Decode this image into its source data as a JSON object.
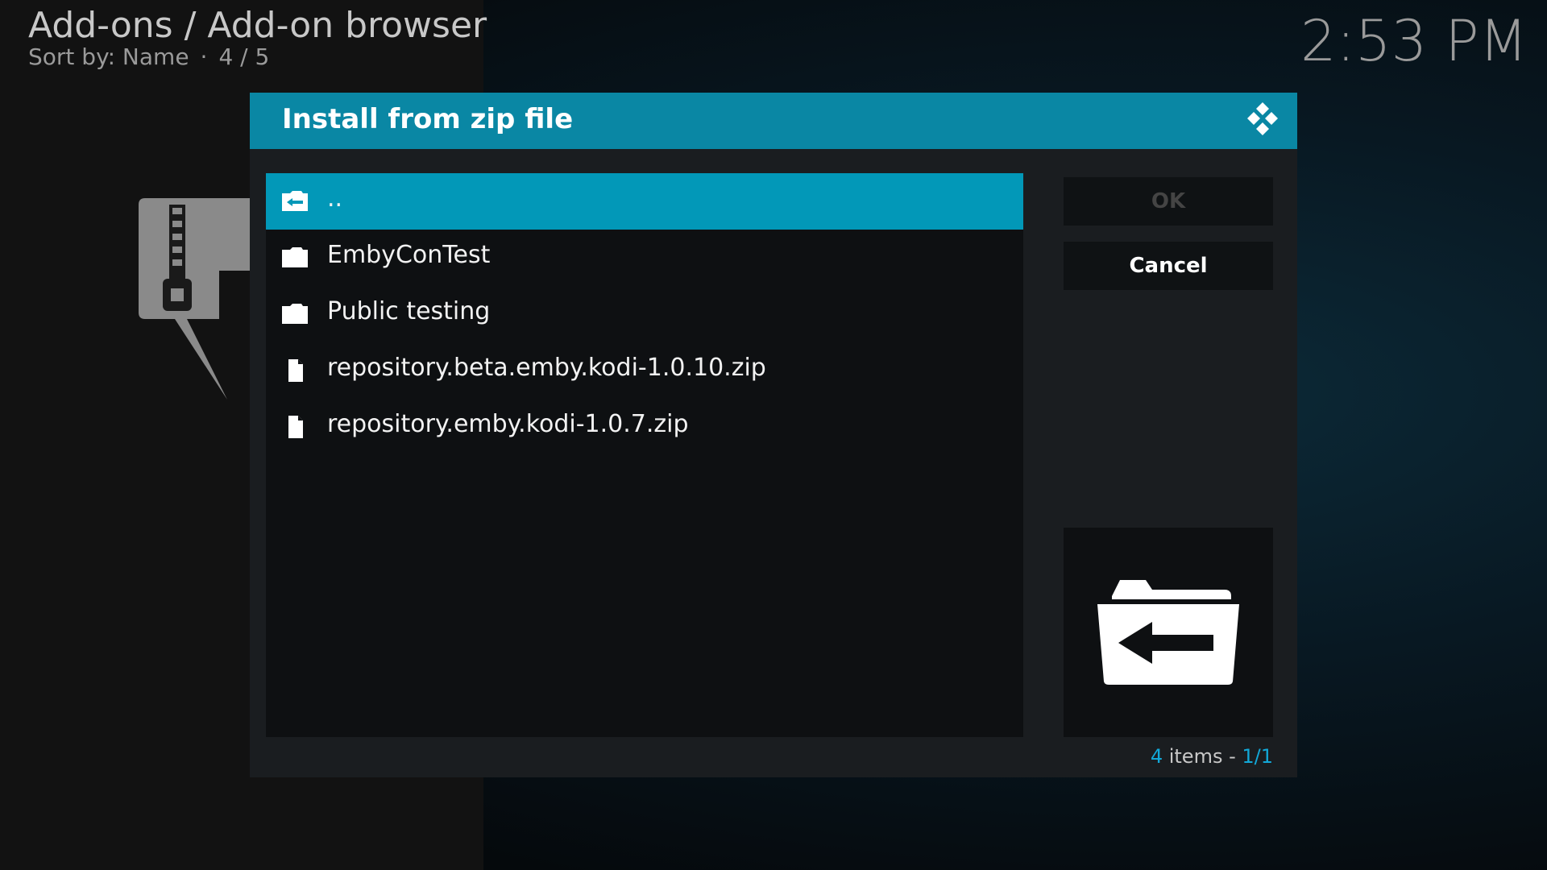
{
  "header": {
    "title": "Add-ons / Add-on browser",
    "sort_label": "Sort by: Name",
    "position": "4 / 5"
  },
  "clock": "2:53 PM",
  "dialog": {
    "title": "Install from zip file",
    "items": [
      {
        "label": "..",
        "icon": "folder-back-icon",
        "selected": true
      },
      {
        "label": "EmbyConTest",
        "icon": "folder-icon"
      },
      {
        "label": "Public testing",
        "icon": "folder-icon"
      },
      {
        "label": "repository.beta.emby.kodi-1.0.10.zip",
        "icon": "file-icon"
      },
      {
        "label": "repository.emby.kodi-1.0.7.zip",
        "icon": "file-icon"
      }
    ],
    "ok_label": "OK",
    "cancel_label": "Cancel",
    "items_count": "4",
    "items_word": " items - ",
    "page": "1/1"
  },
  "colors": {
    "accent": "#0a87a4",
    "selection": "#0298b8"
  }
}
